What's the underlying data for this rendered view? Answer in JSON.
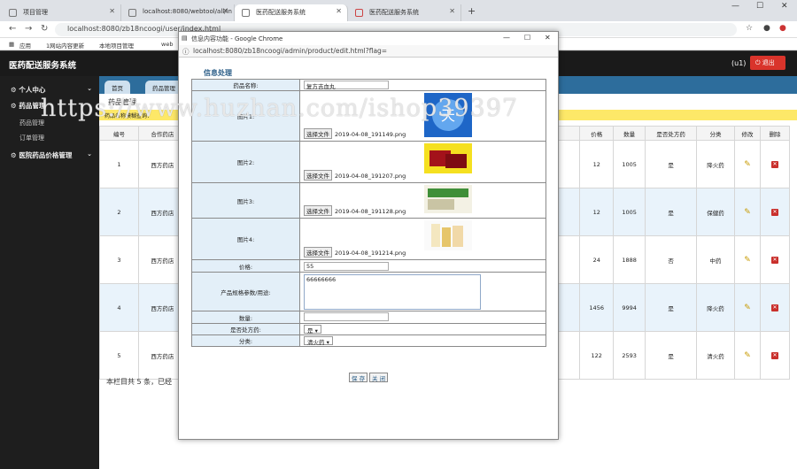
{
  "browser": {
    "tabs": [
      {
        "title": "项目管理"
      },
      {
        "title": "localhost:8080/webtool/all/in"
      },
      {
        "title": "医药配送服务系统"
      },
      {
        "title": "医药配送服务系统"
      }
    ],
    "url": "localhost:8080/zb18ncoogi/user/index.html",
    "bookmarks": [
      "应用",
      "1网站内容更新",
      "本地项目管理",
      "web"
    ]
  },
  "app": {
    "title": "医药配送服务系统",
    "user": "(u1)",
    "logout_label": "退出"
  },
  "sidebar": {
    "items": [
      {
        "label": "个人中心"
      },
      {
        "label": "药品管理"
      },
      {
        "label": "药品管理"
      },
      {
        "label": "订单管理"
      },
      {
        "label": "医院药品价格管理"
      }
    ]
  },
  "main": {
    "tabs": [
      {
        "label": "首页"
      },
      {
        "label": "药品管理"
      }
    ],
    "title": "药品管理",
    "search_label": "药品名称模糊查询：",
    "table": {
      "headers": [
        "编号",
        "合作药店",
        "价格",
        "数量",
        "是否处方药",
        "分类",
        "修改",
        "删除"
      ],
      "rows": [
        {
          "id": "1",
          "shop": "西方药店",
          "price": "12",
          "qty": "1005",
          "rx": "是",
          "cat": "降火药"
        },
        {
          "id": "2",
          "shop": "西方药店",
          "price": "12",
          "qty": "1005",
          "rx": "是",
          "cat": "保健药"
        },
        {
          "id": "3",
          "shop": "西方药店",
          "price": "24",
          "qty": "1888",
          "rx": "否",
          "cat": "中药"
        },
        {
          "id": "4",
          "shop": "西方药店",
          "price": "1456",
          "qty": "9994",
          "rx": "是",
          "cat": "降火药"
        },
        {
          "id": "5",
          "shop": "西方药店",
          "price": "122",
          "qty": "2593",
          "rx": "是",
          "cat": "清火药"
        }
      ]
    },
    "footer": "本栏目共 5 条，已经"
  },
  "popup": {
    "window_title": "信息内容功能 - Google Chrome",
    "url": "localhost:8080/zb18ncoogi/admin/product/edit.html?flag=",
    "heading": "信息处理",
    "fields": {
      "name_label": "药品名称:",
      "name_value": "复方吉血丸",
      "img1_label": "图片1:",
      "img2_label": "图片2:",
      "img3_label": "图片3:",
      "img4_label": "图片4:",
      "choose_file": "选择文件",
      "img1_file": "2019-04-08_191149.png",
      "img2_file": "2019-04-08_191207.png",
      "img3_file": "2019-04-08_191128.png",
      "img4_file": "2019-04-08_191214.png",
      "price_label": "价格:",
      "price_value": "55",
      "desc_label": "产品规格参数/用途:",
      "desc_value": "66666666",
      "qty_label": "数量:",
      "qty_value": "",
      "rx_label": "是否处方药:",
      "rx_value": "是",
      "cat_label": "分类:",
      "cat_value": "清火药"
    },
    "save_label": "保 存",
    "close_label": "关 闭"
  },
  "watermark": "https://www.huzhan.com/ishop39397",
  "colors": {
    "accent": "#2d6d9c",
    "logout": "#d9342b",
    "search_bg": "#fde868"
  }
}
